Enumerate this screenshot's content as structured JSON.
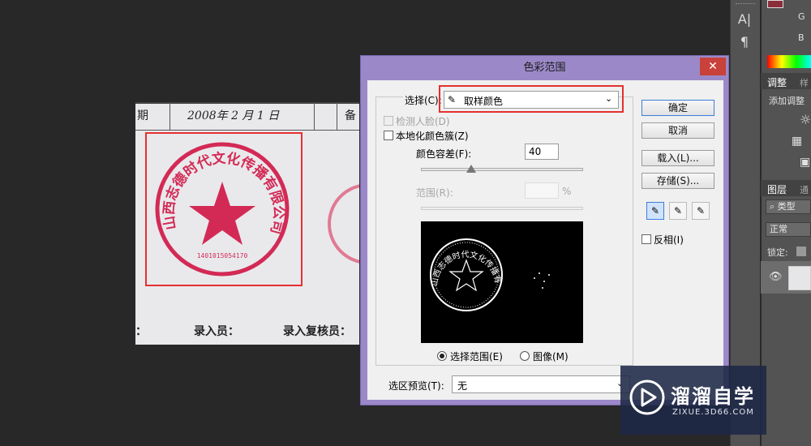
{
  "document": {
    "header_cells": [
      "期",
      "2008年 2 月 1 日",
      "备"
    ],
    "seal_text": "山西志德时代文化传播有限公司",
    "seal_number": "1401015054170",
    "footer_labels": [
      "：",
      "录入员：",
      "录入复核员："
    ],
    "colors": {
      "seal": "#d32a55",
      "selection_box": "#e53030"
    }
  },
  "dialog": {
    "title": "色彩范围",
    "close_label": "✕",
    "select_label": "选择(C):",
    "select_value": "取样颜色",
    "detect_faces_label": "检测人脸(D)",
    "localized_clusters_label": "本地化颜色簇(Z)",
    "fuzziness_label": "颜色容差(F):",
    "fuzziness_value": "40",
    "fuzziness_percent": 0.31,
    "range_label": "范围(R):",
    "range_unit": "%",
    "radio_selection_label": "选择范围(E)",
    "radio_image_label": "图像(M)",
    "selection_preview_label": "选区预览(T):",
    "selection_preview_value": "无",
    "buttons": {
      "ok": "确定",
      "cancel": "取消",
      "load": "载入(L)...",
      "save": "存储(S)..."
    },
    "invert_label": "反相(I)"
  },
  "right_panel": {
    "color_labels": [
      "G",
      "B"
    ],
    "tab_adjust": "调整",
    "tab_style": "样",
    "add_adjust": "添加调整",
    "layers_tab": "图层",
    "channels_tab": "通",
    "kind_placeholder": "类型",
    "blend_mode": "正常",
    "lock_label": "锁定:",
    "accent": "#8b2d3a"
  },
  "watermark": {
    "title": "溜溜自学",
    "url": "ZIXUE.3D66.COM"
  }
}
